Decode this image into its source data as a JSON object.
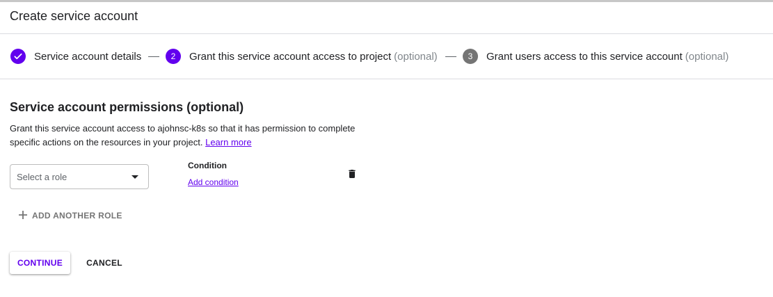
{
  "header": {
    "title": "Create service account"
  },
  "stepper": {
    "steps": [
      {
        "label": "Service account details",
        "optional": "",
        "state": "done",
        "icon": "check-icon"
      },
      {
        "number": "2",
        "label": "Grant this service account access to project",
        "optional": "(optional)",
        "state": "active"
      },
      {
        "number": "3",
        "label": "Grant users access to this service account",
        "optional": "(optional)",
        "state": "inactive"
      }
    ]
  },
  "permissions": {
    "title": "Service account permissions (optional)",
    "description": "Grant this service account access to ajohnsc-k8s so that it has permission to complete specific actions on the resources in your project.",
    "learn_more": "Learn more",
    "role_select": {
      "placeholder": "Select a role",
      "icon": "dropdown-arrow-icon"
    },
    "condition": {
      "label": "Condition",
      "link": "Add condition"
    },
    "delete_icon": "trash-icon",
    "add_another_role": {
      "icon": "plus-icon",
      "label": "ADD ANOTHER ROLE"
    }
  },
  "actions": {
    "continue": "CONTINUE",
    "cancel": "CANCEL"
  },
  "colors": {
    "accent": "#6200ee",
    "inactive_step": "#757575",
    "divider": "#dadce0"
  }
}
